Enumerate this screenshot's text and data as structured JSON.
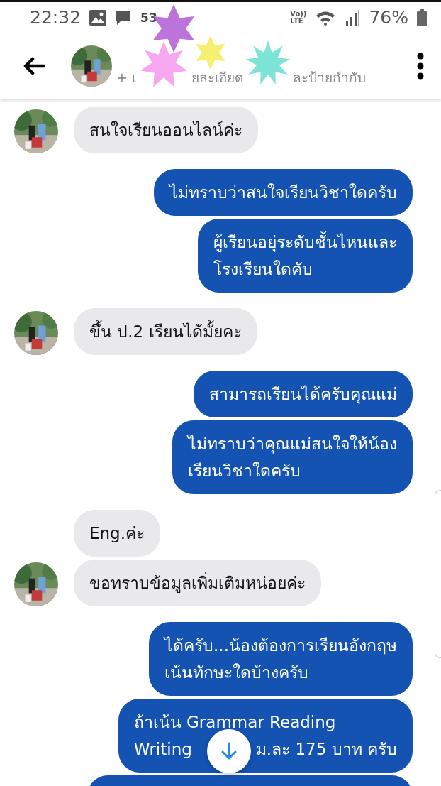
{
  "status_bar": {
    "time": "22:32",
    "notification_count": "53",
    "network_top": "Vo))",
    "network_bottom": "LTE",
    "battery": "76%"
  },
  "header": {
    "subtitle_parts": [
      "+ เ",
      "ยละเอียด",
      "ละป้ายกำกับ"
    ]
  },
  "messages": [
    {
      "kind": "received",
      "avatar": true,
      "lines": [
        [
          "สนใจเรียนออนไลน์ค่ะ"
        ]
      ]
    },
    {
      "kind": "sent",
      "lines": [
        [
          "ไม่ทราบว่าสนใจเรียนวิชาใดครับ"
        ]
      ]
    },
    {
      "kind": "sent",
      "lines": [
        [
          "ผู้เรียนอยุ่ระดับชั้นไหนและ"
        ],
        [
          "โรงเรียนใดคับ"
        ]
      ]
    },
    {
      "kind": "received",
      "avatar": true,
      "lines": [
        [
          "ขึ้น ป.2 เรียนได้มั้ยคะ"
        ]
      ]
    },
    {
      "kind": "sent",
      "lines": [
        [
          "สามารถเรียนได้ครับคุณแม่"
        ]
      ]
    },
    {
      "kind": "sent",
      "lines": [
        [
          "ไม่ทราบว่าคุณแม่สนใจให้น้อง"
        ],
        [
          "เรียนวิชาใดครับ"
        ]
      ]
    },
    {
      "kind": "received",
      "avatar": false,
      "lines": [
        [
          "Eng.ค่ะ"
        ]
      ]
    },
    {
      "kind": "received",
      "avatar": true,
      "lines": [
        [
          "ขอทราบข้อมูลเพิ่มเติมหน่อยค่ะ"
        ]
      ]
    },
    {
      "kind": "sent",
      "lines": [
        [
          "ได้ครับ...น้องต้องการเรียนอังกฤษ"
        ],
        [
          "เน้นทักษะใดบ้างครับ"
        ]
      ]
    },
    {
      "kind": "sent",
      "lines": [
        [
          "ถ้าเน้น Grammar Reading"
        ],
        [
          "Writing",
          "ม.ละ 175 บาท ครับ"
        ]
      ]
    },
    {
      "kind": "sent"
    }
  ]
}
